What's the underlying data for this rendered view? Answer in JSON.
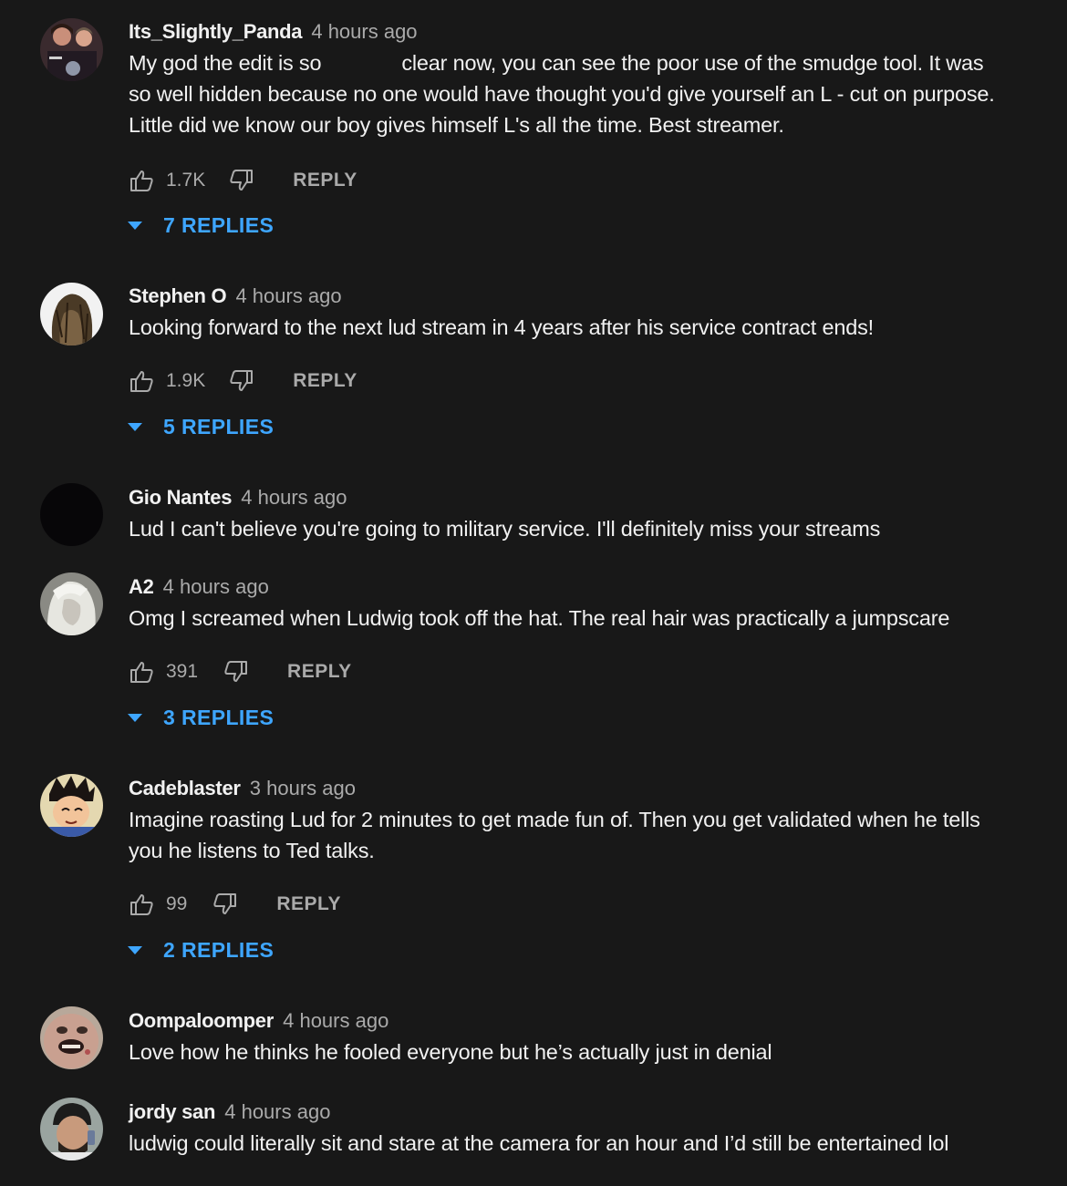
{
  "comments": [
    {
      "author": "Its_Slightly_Panda",
      "time": "4 hours ago",
      "text_lines": [
        "My god the edit is so",
        "clear now, you can see the poor use of the smudge tool. It was",
        "so well hidden because no one would have thought you'd give yourself an L - cut on purpose.",
        "Little did we know our boy gives himself L's all the time. Best streamer."
      ],
      "likes": "1.7K",
      "reply_label": "REPLY",
      "replies_label": "7 REPLIES",
      "avatar_icon": "group-photo-avatar"
    },
    {
      "author": "Stephen O",
      "time": "4 hours ago",
      "text_lines": [
        "Looking forward to the next lud stream in 4 years after his service contract ends!"
      ],
      "likes": "1.9K",
      "reply_label": "REPLY",
      "replies_label": "5 REPLIES",
      "avatar_icon": "long-hair-avatar"
    },
    {
      "author": "Gio Nantes",
      "time": "4 hours ago",
      "text_lines": [
        "Lud I can't believe you're going to military service. I'll definitely miss your streams"
      ],
      "avatar_icon": "dark-avatar"
    },
    {
      "author": "A2",
      "time": "4 hours ago",
      "text_lines": [
        "Omg I screamed when Ludwig took off the hat. The real hair was practically a jumpscare"
      ],
      "likes": "391",
      "reply_label": "REPLY",
      "replies_label": "3 REPLIES",
      "avatar_icon": "white-hair-avatar"
    },
    {
      "author": "Cadeblaster",
      "time": "3 hours ago",
      "text_lines": [
        "Imagine roasting Lud for 2 minutes to get made fun of. Then you get validated when he tells",
        "you he listens to Ted talks."
      ],
      "likes": "99",
      "reply_label": "REPLY",
      "replies_label": "2 REPLIES",
      "avatar_icon": "anime-avatar"
    },
    {
      "author": "Oompaloomper",
      "time": "4 hours ago",
      "text_lines": [
        "Love how he thinks he fooled everyone but he’s actually just in denial"
      ],
      "avatar_icon": "face-closeup-avatar"
    },
    {
      "author": "jordy san",
      "time": "4 hours ago",
      "text_lines": [
        "ludwig could literally sit and stare at the camera for an hour and I’d still be entertained lol"
      ],
      "avatar_icon": "beanie-selfie-avatar"
    }
  ],
  "colors": {
    "background": "#181818",
    "text": "#f1f1f1",
    "secondary": "#aaaaaa",
    "link_blue": "#3ea6ff"
  }
}
